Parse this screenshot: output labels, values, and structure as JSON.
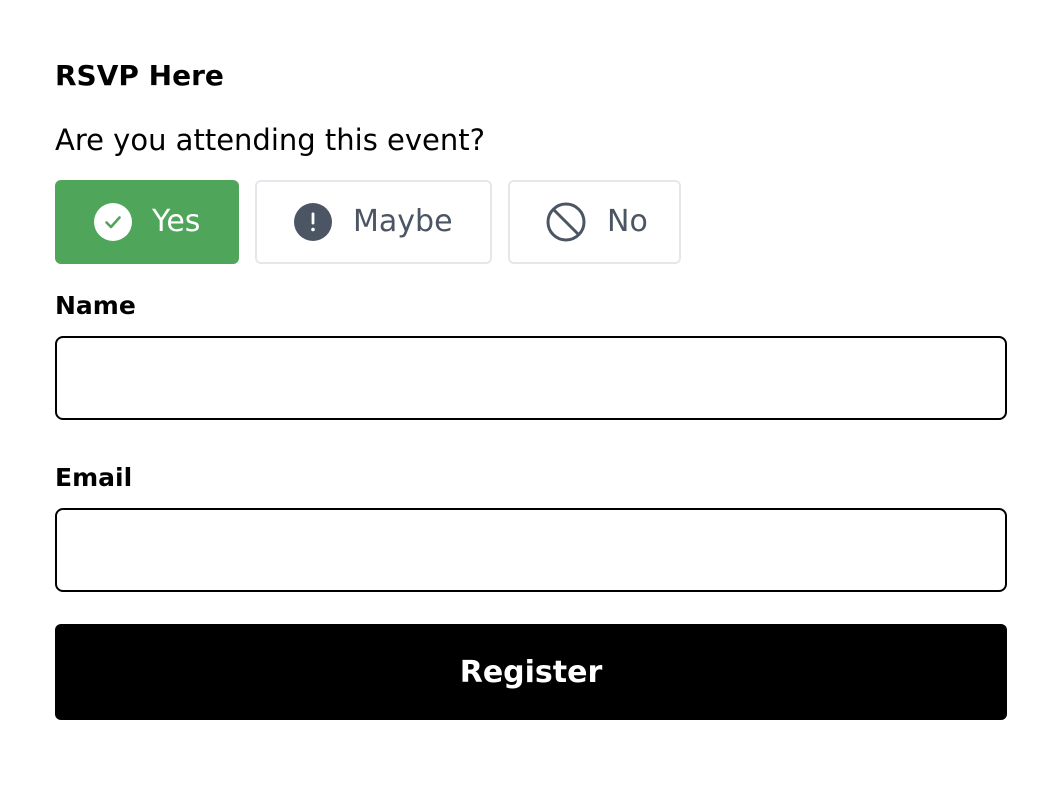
{
  "form": {
    "title": "RSVP Here",
    "question": "Are you attending this event?",
    "options": [
      {
        "label": "Yes",
        "icon": "check-circle-icon",
        "selected": true
      },
      {
        "label": "Maybe",
        "icon": "exclamation-circle-icon",
        "selected": false
      },
      {
        "label": "No",
        "icon": "ban-icon",
        "selected": false
      }
    ],
    "name_label": "Name",
    "name_value": "",
    "email_label": "Email",
    "email_value": "",
    "submit_label": "Register"
  },
  "colors": {
    "selected_option_bg": "#4fa55a",
    "option_border": "#e5e7eb",
    "option_text": "#4b5563",
    "submit_bg": "#000000"
  }
}
